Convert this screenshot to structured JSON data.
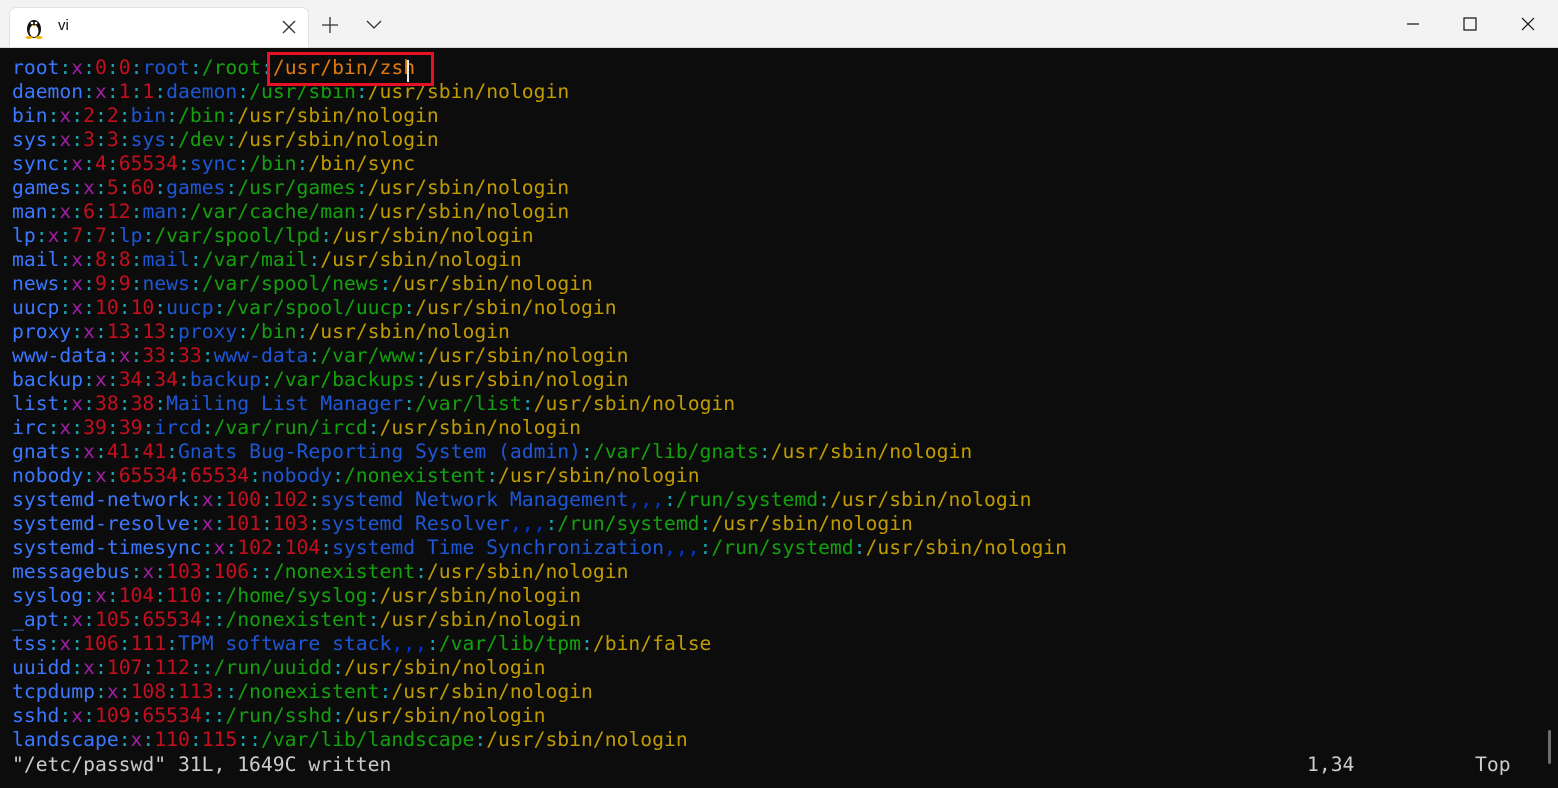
{
  "window": {
    "tab_title": "vi",
    "tab_icon": "linux-penguin-icon"
  },
  "file_lines": [
    [
      "root",
      "x",
      "0",
      "0",
      "root",
      "/root",
      "/usr/bin/zsh"
    ],
    [
      "daemon",
      "x",
      "1",
      "1",
      "daemon",
      "/usr/sbin",
      "/usr/sbin/nologin"
    ],
    [
      "bin",
      "x",
      "2",
      "2",
      "bin",
      "/bin",
      "/usr/sbin/nologin"
    ],
    [
      "sys",
      "x",
      "3",
      "3",
      "sys",
      "/dev",
      "/usr/sbin/nologin"
    ],
    [
      "sync",
      "x",
      "4",
      "65534",
      "sync",
      "/bin",
      "/bin/sync"
    ],
    [
      "games",
      "x",
      "5",
      "60",
      "games",
      "/usr/games",
      "/usr/sbin/nologin"
    ],
    [
      "man",
      "x",
      "6",
      "12",
      "man",
      "/var/cache/man",
      "/usr/sbin/nologin"
    ],
    [
      "lp",
      "x",
      "7",
      "7",
      "lp",
      "/var/spool/lpd",
      "/usr/sbin/nologin"
    ],
    [
      "mail",
      "x",
      "8",
      "8",
      "mail",
      "/var/mail",
      "/usr/sbin/nologin"
    ],
    [
      "news",
      "x",
      "9",
      "9",
      "news",
      "/var/spool/news",
      "/usr/sbin/nologin"
    ],
    [
      "uucp",
      "x",
      "10",
      "10",
      "uucp",
      "/var/spool/uucp",
      "/usr/sbin/nologin"
    ],
    [
      "proxy",
      "x",
      "13",
      "13",
      "proxy",
      "/bin",
      "/usr/sbin/nologin"
    ],
    [
      "www-data",
      "x",
      "33",
      "33",
      "www-data",
      "/var/www",
      "/usr/sbin/nologin"
    ],
    [
      "backup",
      "x",
      "34",
      "34",
      "backup",
      "/var/backups",
      "/usr/sbin/nologin"
    ],
    [
      "list",
      "x",
      "38",
      "38",
      "Mailing List Manager",
      "/var/list",
      "/usr/sbin/nologin"
    ],
    [
      "irc",
      "x",
      "39",
      "39",
      "ircd",
      "/var/run/ircd",
      "/usr/sbin/nologin"
    ],
    [
      "gnats",
      "x",
      "41",
      "41",
      "Gnats Bug-Reporting System (admin)",
      "/var/lib/gnats",
      "/usr/sbin/nologin"
    ],
    [
      "nobody",
      "x",
      "65534",
      "65534",
      "nobody",
      "/nonexistent",
      "/usr/sbin/nologin"
    ],
    [
      "systemd-network",
      "x",
      "100",
      "102",
      "systemd Network Management,,,",
      "/run/systemd",
      "/usr/sbin/nologin"
    ],
    [
      "systemd-resolve",
      "x",
      "101",
      "103",
      "systemd Resolver,,,",
      "/run/systemd",
      "/usr/sbin/nologin"
    ],
    [
      "systemd-timesync",
      "x",
      "102",
      "104",
      "systemd Time Synchronization,,,",
      "/run/systemd",
      "/usr/sbin/nologin"
    ],
    [
      "messagebus",
      "x",
      "103",
      "106",
      "",
      "/nonexistent",
      "/usr/sbin/nologin"
    ],
    [
      "syslog",
      "x",
      "104",
      "110",
      "",
      "/home/syslog",
      "/usr/sbin/nologin"
    ],
    [
      "_apt",
      "x",
      "105",
      "65534",
      "",
      "/nonexistent",
      "/usr/sbin/nologin"
    ],
    [
      "tss",
      "x",
      "106",
      "111",
      "TPM software stack,,,",
      "/var/lib/tpm",
      "/bin/false"
    ],
    [
      "uuidd",
      "x",
      "107",
      "112",
      "",
      "/run/uuidd",
      "/usr/sbin/nologin"
    ],
    [
      "tcpdump",
      "x",
      "108",
      "113",
      "",
      "/nonexistent",
      "/usr/sbin/nologin"
    ],
    [
      "sshd",
      "x",
      "109",
      "65534",
      "",
      "/run/sshd",
      "/usr/sbin/nologin"
    ],
    [
      "landscape",
      "x",
      "110",
      "115",
      "",
      "/var/lib/landscape",
      "/usr/sbin/nologin"
    ]
  ],
  "status": {
    "message": "\"/etc/passwd\" 31L, 1649C written",
    "cursor_position": "1,34",
    "scroll_position": "Top"
  },
  "colors": {
    "highlight_box": "#e81123",
    "terminal_bg": "#0c0c0c"
  }
}
